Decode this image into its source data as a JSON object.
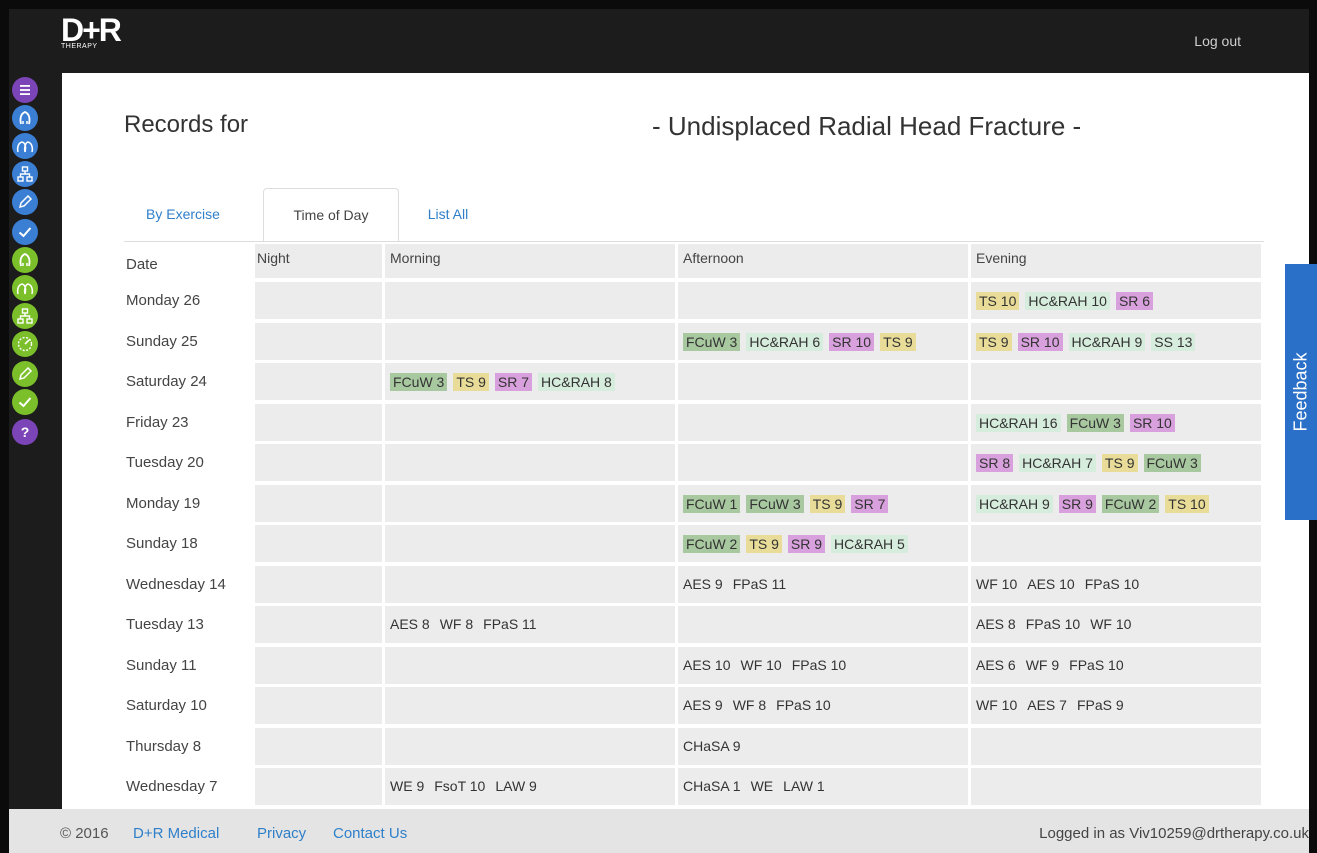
{
  "header": {
    "logo_main": "D+R",
    "logo_sub": "THERAPY",
    "logout": "Log out"
  },
  "sidebar": {
    "items": [
      {
        "icon": "menu-icon",
        "color": "#7c45b7"
      },
      {
        "icon": "head-icon",
        "color": "#3a7fd4"
      },
      {
        "icon": "heads-icon",
        "color": "#3a7fd4"
      },
      {
        "icon": "hierarchy-icon",
        "color": "#3a7fd4"
      },
      {
        "icon": "pencil-icon",
        "color": "#3a7fd4"
      },
      {
        "icon": "check-icon",
        "color": "#3a7fd4"
      },
      {
        "icon": "head-icon",
        "color": "#7bbf2a"
      },
      {
        "icon": "heads-icon",
        "color": "#7bbf2a"
      },
      {
        "icon": "hierarchy-icon",
        "color": "#7bbf2a"
      },
      {
        "icon": "gauge-icon",
        "color": "#7bbf2a"
      },
      {
        "icon": "pencil-icon",
        "color": "#7bbf2a"
      },
      {
        "icon": "check-icon",
        "color": "#7bbf2a"
      },
      {
        "icon": "help-icon",
        "color": "#7c45b7",
        "label": "?"
      }
    ]
  },
  "page": {
    "title_left": "Records for",
    "title_right": "- Undisplaced Radial Head Fracture -"
  },
  "tabs": [
    {
      "label": "By Exercise",
      "active": false
    },
    {
      "label": "Time of Day",
      "active": true
    },
    {
      "label": "List All",
      "active": false
    }
  ],
  "table": {
    "headers": [
      "Date",
      "Night",
      "Morning",
      "Afternoon",
      "Evening"
    ],
    "tag_colors": {
      "FCuW": "#a8c8a0",
      "TS": "#e8dc98",
      "SR": "#d8a0dc",
      "HC&RAH": "#d6ecdc",
      "SS": "#d6ecdc"
    },
    "rows": [
      {
        "date": "Monday 26",
        "night": [],
        "morning": [],
        "afternoon": [],
        "evening": [
          {
            "t": "TS 10",
            "k": "TS"
          },
          {
            "t": "HC&RAH 10",
            "k": "HC&RAH"
          },
          {
            "t": "SR 6",
            "k": "SR"
          }
        ]
      },
      {
        "date": "Sunday 25",
        "night": [],
        "morning": [],
        "afternoon": [
          {
            "t": "FCuW 3",
            "k": "FCuW"
          },
          {
            "t": "HC&RAH 6",
            "k": "HC&RAH"
          },
          {
            "t": "SR 10",
            "k": "SR"
          },
          {
            "t": "TS 9",
            "k": "TS"
          }
        ],
        "evening": [
          {
            "t": "TS 9",
            "k": "TS"
          },
          {
            "t": "SR 10",
            "k": "SR"
          },
          {
            "t": "HC&RAH 9",
            "k": "HC&RAH"
          },
          {
            "t": "SS 13",
            "k": "SS"
          }
        ]
      },
      {
        "date": "Saturday 24",
        "night": [],
        "morning": [
          {
            "t": "FCuW 3",
            "k": "FCuW"
          },
          {
            "t": "TS 9",
            "k": "TS"
          },
          {
            "t": "SR 7",
            "k": "SR"
          },
          {
            "t": "HC&RAH 8",
            "k": "HC&RAH"
          }
        ],
        "afternoon": [],
        "evening": []
      },
      {
        "date": "Friday 23",
        "night": [],
        "morning": [],
        "afternoon": [],
        "evening": [
          {
            "t": "HC&RAH 16",
            "k": "HC&RAH"
          },
          {
            "t": "FCuW 3",
            "k": "FCuW"
          },
          {
            "t": "SR 10",
            "k": "SR"
          }
        ]
      },
      {
        "date": "Tuesday 20",
        "night": [],
        "morning": [],
        "afternoon": [],
        "evening": [
          {
            "t": "SR 8",
            "k": "SR"
          },
          {
            "t": "HC&RAH 7",
            "k": "HC&RAH"
          },
          {
            "t": "TS 9",
            "k": "TS"
          },
          {
            "t": "FCuW 3",
            "k": "FCuW"
          }
        ]
      },
      {
        "date": "Monday 19",
        "night": [],
        "morning": [],
        "afternoon": [
          {
            "t": "FCuW 1",
            "k": "FCuW"
          },
          {
            "t": "FCuW 3",
            "k": "FCuW"
          },
          {
            "t": "TS 9",
            "k": "TS"
          },
          {
            "t": "SR 7",
            "k": "SR"
          }
        ],
        "evening": [
          {
            "t": "HC&RAH 9",
            "k": "HC&RAH"
          },
          {
            "t": "SR 9",
            "k": "SR"
          },
          {
            "t": "FCuW 2",
            "k": "FCuW"
          },
          {
            "t": "TS 10",
            "k": "TS"
          }
        ]
      },
      {
        "date": "Sunday 18",
        "night": [],
        "morning": [],
        "afternoon": [
          {
            "t": "FCuW 2",
            "k": "FCuW"
          },
          {
            "t": "TS 9",
            "k": "TS"
          },
          {
            "t": "SR 9",
            "k": "SR"
          },
          {
            "t": "HC&RAH 5",
            "k": "HC&RAH"
          }
        ],
        "evening": []
      },
      {
        "date": "Wednesday 14",
        "night": [],
        "morning": [],
        "afternoon": [
          {
            "t": "AES 9"
          },
          {
            "t": "FPaS 11"
          }
        ],
        "evening": [
          {
            "t": "WF 10"
          },
          {
            "t": "AES 10"
          },
          {
            "t": "FPaS 10"
          }
        ]
      },
      {
        "date": "Tuesday 13",
        "night": [],
        "morning": [
          {
            "t": "AES 8"
          },
          {
            "t": "WF 8"
          },
          {
            "t": "FPaS 11"
          }
        ],
        "afternoon": [],
        "evening": [
          {
            "t": "AES 8"
          },
          {
            "t": "FPaS 10"
          },
          {
            "t": "WF 10"
          }
        ]
      },
      {
        "date": "Sunday 11",
        "night": [],
        "morning": [],
        "afternoon": [
          {
            "t": "AES 10"
          },
          {
            "t": "WF 10"
          },
          {
            "t": "FPaS 10"
          }
        ],
        "evening": [
          {
            "t": "AES 6"
          },
          {
            "t": "WF 9"
          },
          {
            "t": "FPaS 10"
          }
        ]
      },
      {
        "date": "Saturday 10",
        "night": [],
        "morning": [],
        "afternoon": [
          {
            "t": "AES 9"
          },
          {
            "t": "WF 8"
          },
          {
            "t": "FPaS 10"
          }
        ],
        "evening": [
          {
            "t": "WF 10"
          },
          {
            "t": "AES 7"
          },
          {
            "t": "FPaS 9"
          }
        ]
      },
      {
        "date": "Thursday 8",
        "night": [],
        "morning": [],
        "afternoon": [
          {
            "t": "CHaSA 9"
          }
        ],
        "evening": []
      },
      {
        "date": "Wednesday 7",
        "night": [],
        "morning": [
          {
            "t": "WE 9"
          },
          {
            "t": "FsoT 10"
          },
          {
            "t": "LAW 9"
          }
        ],
        "afternoon": [
          {
            "t": "CHaSA 1"
          },
          {
            "t": "WE"
          },
          {
            "t": "LAW 1"
          }
        ],
        "evening": []
      }
    ]
  },
  "feedback": "Feedback",
  "footer": {
    "copyright": "© 2016",
    "links": [
      "D+R Medical",
      "Privacy",
      "Contact Us"
    ],
    "logged_in": "Logged in as Viv10259@drtherapy.co.uk"
  }
}
